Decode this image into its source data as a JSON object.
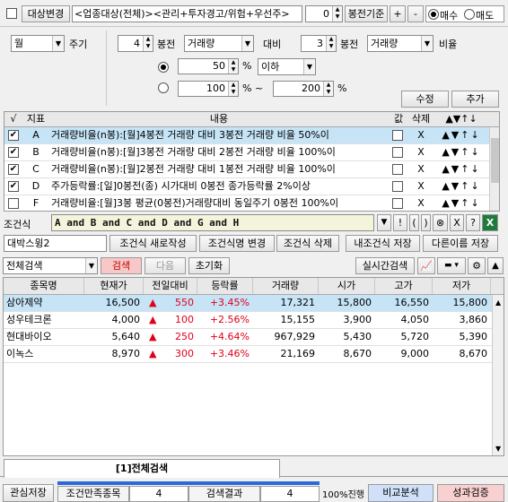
{
  "toolbar": {
    "target_label": "대상변경",
    "filter_text": "<업종대상(전체)><관리+투자경고/위험+우선주>",
    "base_value": "0",
    "base_label": "봉전기준",
    "plus": "+",
    "minus": "-",
    "buy_label": "매수",
    "sell_label": "매도"
  },
  "condition_form": {
    "period": "월",
    "period_label": "주기",
    "n_bong_1": "4",
    "bong_label_1": "봉전",
    "metric_1": "거래량",
    "vs_label": "대비",
    "n_bong_2": "3",
    "bong_label_2": "봉전",
    "metric_2": "거래량",
    "ratio_label": "비율",
    "value_1": "50",
    "unit_1": "%",
    "compare": "이하",
    "value_2a": "100",
    "unit_2a": "% ~",
    "value_2b": "200",
    "unit_2b": "%",
    "modify_label": "수정",
    "add_label": "추가"
  },
  "condition_table": {
    "headers": {
      "check": "√",
      "index": "지표",
      "content": "내용",
      "value": "값",
      "delete": "삭제",
      "order": "▲▼↑↓"
    },
    "rows": [
      {
        "checked": "✔",
        "id": "A",
        "content": "거래량비율(n봉):[월]4봉전 거래량 대비 3봉전 거래량 비율 50%이",
        "del": "X",
        "order": "▲▼↑↓"
      },
      {
        "checked": "✔",
        "id": "B",
        "content": "거래량비율(n봉):[월]3봉전 거래량 대비 2봉전 거래량 비율 100%이",
        "del": "X",
        "order": "▲▼↑↓"
      },
      {
        "checked": "✔",
        "id": "C",
        "content": "거래량비율(n봉):[월]2봉전 거래량 대비 1봉전 거래량 비율 100%이",
        "del": "X",
        "order": "▲▼↑↓"
      },
      {
        "checked": "✔",
        "id": "D",
        "content": "주가등락률:[일]0봉전(종) 시가대비 0봉전 종가등락률 2%이상",
        "del": "X",
        "order": "▲▼↑↓"
      },
      {
        "checked": "",
        "id": "F",
        "content": "거래량비율:[월]3봉 평균(0봉전)거래량대비 동일주기 0봉전 100%이",
        "del": "X",
        "order": "▲▼↑↓"
      }
    ]
  },
  "formula": {
    "label": "조건식",
    "value": "A and B and C and D and G and H",
    "btns": [
      "▼",
      "!",
      "(",
      ")",
      "⊗",
      "X",
      "?"
    ]
  },
  "save_bar": {
    "name": "대박스윙2",
    "new_label": "조건식 새로작성",
    "rename_label": "조건식명 변경",
    "delete_label": "조건식 삭제",
    "my_save_label": "내조건식 저장",
    "save_as_label": "다른이름 저장"
  },
  "search_bar": {
    "mode": "전체검색",
    "search_label": "검색",
    "next_label": "다음",
    "reset_label": "초기화",
    "realtime_label": "실시간검색"
  },
  "results": {
    "headers": [
      "종목명",
      "현재가",
      "전일대비",
      "등락률",
      "거래량",
      "시가",
      "고가",
      "저가"
    ],
    "rows": [
      {
        "name": "삼아제약",
        "price": "16,500",
        "arrow": "▲",
        "change": "550",
        "rate": "+3.45%",
        "volume": "17,321",
        "open": "15,800",
        "high": "16,550",
        "low": "15,800"
      },
      {
        "name": "성우테크론",
        "price": "4,000",
        "arrow": "▲",
        "change": "100",
        "rate": "+2.56%",
        "volume": "15,155",
        "open": "3,900",
        "high": "4,050",
        "low": "3,860"
      },
      {
        "name": "현대바이오",
        "price": "5,640",
        "arrow": "▲",
        "change": "250",
        "rate": "+4.64%",
        "volume": "967,929",
        "open": "5,430",
        "high": "5,720",
        "low": "5,390"
      },
      {
        "name": "이녹스",
        "price": "8,970",
        "arrow": "▲",
        "change": "300",
        "rate": "+3.46%",
        "volume": "21,169",
        "open": "8,670",
        "high": "9,000",
        "low": "8,670"
      }
    ]
  },
  "bottom_tab": {
    "label": "[1]전체검색"
  },
  "status": {
    "watch_save": "관심저장",
    "matched_label": "조건만족종목",
    "matched": "4",
    "result_label": "검색결과",
    "result": "4",
    "progress_text": "100%진행",
    "progress": 1.0,
    "compare_label": "비교분석",
    "verify_label": "성과검증"
  },
  "colors": {
    "selected_row": "#c6e4f6",
    "formula_bg": "#f4f4dc",
    "search_button": "#f8c8c8",
    "compare_button": "#cfe0f8",
    "verify_button": "#f8d0d0",
    "up_red": "#e0001a",
    "progress": "#2a6ad8"
  }
}
